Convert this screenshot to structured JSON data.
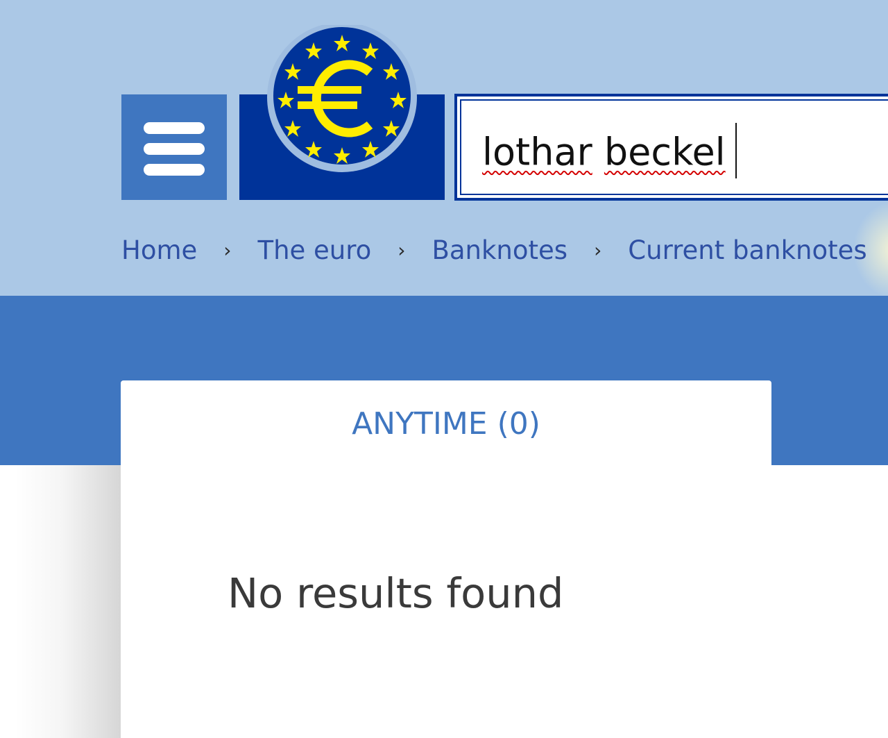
{
  "colors": {
    "header_background": "#abc8e6",
    "band_background": "#3f76c0",
    "brand_navy": "#003399",
    "euro_yellow": "#ffed00",
    "link_blue": "#2e4fa3"
  },
  "header": {
    "menu_icon": "hamburger-menu-icon",
    "logo_icon": "euro-symbol-circle-of-stars-icon"
  },
  "search": {
    "value_word1": "lothar",
    "value_word2": "beckel"
  },
  "breadcrumb": {
    "items": [
      "Home",
      "The euro",
      "Banknotes",
      "Current banknotes"
    ],
    "separator": "›"
  },
  "results": {
    "tab_label": "ANYTIME (0)",
    "message": "No results found"
  }
}
